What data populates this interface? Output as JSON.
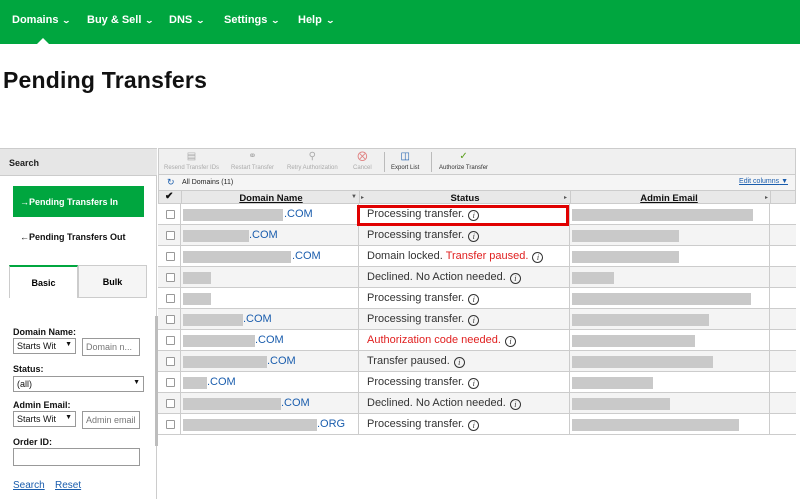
{
  "nav": {
    "items": [
      {
        "label": "Domains"
      },
      {
        "label": "Buy & Sell"
      },
      {
        "label": "DNS"
      },
      {
        "label": "Settings"
      },
      {
        "label": "Help"
      }
    ],
    "active": "Domains"
  },
  "page": {
    "title": "Pending Transfers"
  },
  "sidebar": {
    "header": "Search",
    "pending_in": "Pending Transfers In",
    "pending_out": "Pending Transfers Out",
    "tabs": [
      "Basic",
      "Bulk"
    ],
    "domain_name_label": "Domain Name:",
    "domain_match_value": "Starts Wit",
    "domain_placeholder": "Domain n...",
    "status_label": "Status:",
    "status_value": "(all)",
    "admin_email_label": "Admin Email:",
    "admin_match_value": "Starts Wit",
    "admin_placeholder": "Admin email",
    "order_id_label": "Order ID:",
    "search_link": "Search",
    "reset_link": "Reset"
  },
  "toolbar": {
    "buttons": [
      {
        "label": "Resend Transfer IDs",
        "icon": "resend-icon",
        "enabled": false
      },
      {
        "label": "Restart Transfer",
        "icon": "restart-icon",
        "enabled": false
      },
      {
        "label": "Retry Authorization",
        "icon": "retry-icon",
        "enabled": false
      },
      {
        "label": "Cancel",
        "icon": "cancel-icon",
        "enabled": false
      },
      {
        "label": "Export List",
        "icon": "export-icon",
        "enabled": true
      },
      {
        "label": "Authorize Transfer",
        "icon": "authorize-icon",
        "enabled": true
      }
    ]
  },
  "grid": {
    "filter_label": "All Domains (11)",
    "edit_columns": "Edit columns",
    "columns": [
      "Domain Name",
      "Status",
      "Admin Email"
    ],
    "rows": [
      {
        "tld": ".COM",
        "status": "Processing transfer.",
        "status_red": ""
      },
      {
        "tld": ".COM",
        "status": "Processing transfer.",
        "status_red": ""
      },
      {
        "tld": ".COM",
        "status": "Domain locked.",
        "status_red": "Transfer paused."
      },
      {
        "tld": "",
        "status": "Declined. No Action needed.",
        "status_red": ""
      },
      {
        "tld": "",
        "status": "Processing transfer.",
        "status_red": ""
      },
      {
        "tld": ".COM",
        "status": "Processing transfer.",
        "status_red": ""
      },
      {
        "tld": ".COM",
        "status": "",
        "status_red": "Authorization code needed."
      },
      {
        "tld": ".COM",
        "status": "Transfer paused.",
        "status_red": ""
      },
      {
        "tld": ".COM",
        "status": "Processing transfer.",
        "status_red": ""
      },
      {
        "tld": ".COM",
        "status": "Declined. No Action needed.",
        "status_red": ""
      },
      {
        "tld": ".ORG",
        "status": "Processing transfer.",
        "status_red": ""
      }
    ]
  },
  "colors": {
    "brand": "#00a63f",
    "link": "#1a5dad",
    "alert": "#e02020",
    "highlight": "#e00000"
  }
}
